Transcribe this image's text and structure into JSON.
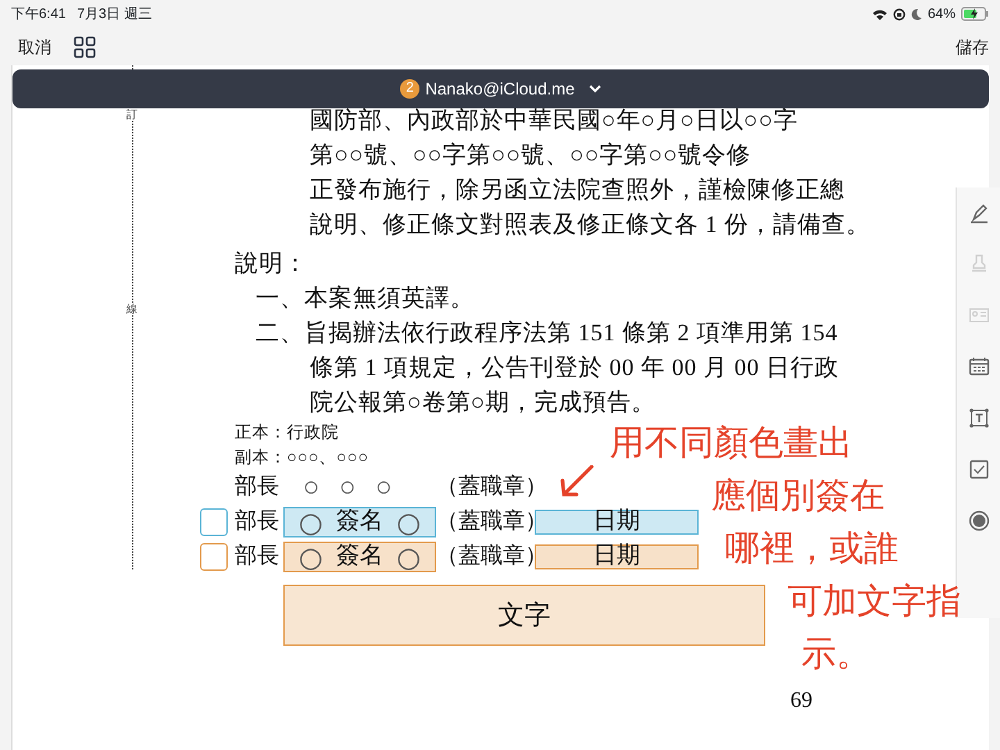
{
  "status_bar": {
    "time": "下午6:41",
    "date": "7月3日 週三",
    "battery": "64%",
    "charging": true
  },
  "toolbar": {
    "cancel": "取消",
    "save": "儲存"
  },
  "account_bar": {
    "badge": "2",
    "account": "Nanako@iCloud.me"
  },
  "margin_marks": [
    "訂",
    "線"
  ],
  "document": {
    "lines": [
      {
        "kind": "text",
        "text": "國防部、內政部於中華民國○年○月○日以○○字"
      },
      {
        "kind": "text",
        "text": "第○○號、○○字第○○號、○○字第○○號令修"
      },
      {
        "kind": "text",
        "text": "正發布施行，除另函立法院查照外，謹檢陳修正總"
      },
      {
        "kind": "text",
        "text": "說明、修正條文對照表及修正條文各 1 份，請備查。"
      },
      {
        "kind": "heading",
        "text": "說明："
      },
      {
        "kind": "item",
        "text": "一、本案無須英譯。"
      },
      {
        "kind": "item",
        "text": "二、旨揭辦法依行政程序法第 151 條第 2 項準用第 154"
      },
      {
        "kind": "text",
        "text": "條第 1 項規定，公告刊登於 00 年 00 月 00 日行政"
      },
      {
        "kind": "text",
        "text": "院公報第○卷第○期，完成預告。"
      },
      {
        "kind": "note",
        "text": "正本：行政院"
      },
      {
        "kind": "note",
        "text": "副本：○○○、○○○"
      }
    ],
    "signature_rows": [
      {
        "label": "部長",
        "marks": [
          "○",
          "○",
          "○"
        ],
        "seal": "（蓋職章）"
      },
      {
        "label": "部長",
        "seal": "（蓋職章）",
        "color": "#5ab4d6",
        "signature": {
          "label": "簽名",
          "marks": [
            "○",
            "○"
          ]
        },
        "date": "日期"
      },
      {
        "label": "部長",
        "seal": "（蓋職章）",
        "color": "#e39a4c",
        "signature": {
          "label": "簽名",
          "marks": [
            "○",
            "○"
          ]
        },
        "date": "日期"
      }
    ],
    "text_field": {
      "label": "文字",
      "color": "#e39a4c"
    },
    "page_number": "69"
  },
  "handwritten_note": {
    "lines": [
      "用不同顏色畫出",
      "應個別簽在",
      "哪裡，或誰",
      "可加文字指",
      "示。"
    ]
  },
  "tools": [
    {
      "kind": "pen",
      "disabled": false
    },
    {
      "kind": "stamp",
      "disabled": true
    },
    {
      "kind": "card",
      "disabled": true
    },
    {
      "kind": "calendar",
      "disabled": false
    },
    {
      "kind": "textbox",
      "disabled": false
    },
    {
      "kind": "checkbox",
      "disabled": false
    },
    {
      "kind": "radio",
      "disabled": false
    }
  ]
}
